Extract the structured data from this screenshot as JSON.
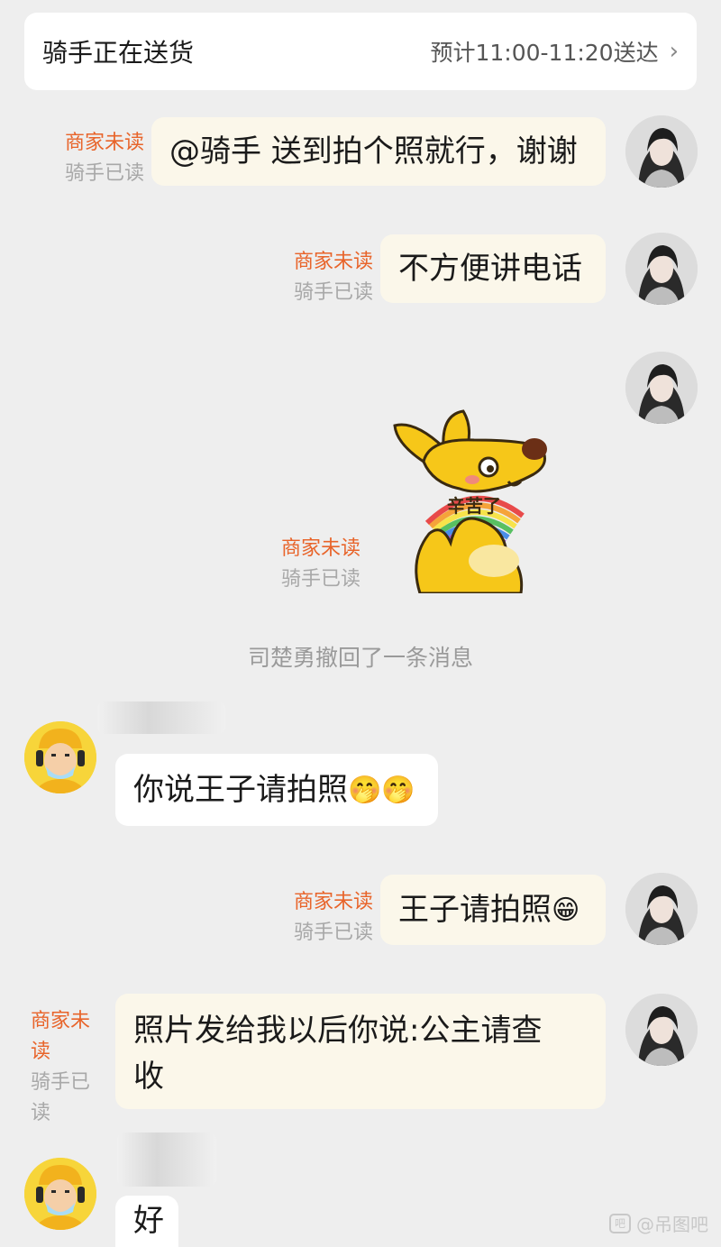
{
  "header": {
    "status": "骑手正在送货",
    "eta": "预计11:00-11:20送达",
    "chevron": "›"
  },
  "messages": [
    {
      "text": "@骑手 送到拍个照就行，谢谢",
      "unread": "商家未读",
      "read": "骑手已读"
    },
    {
      "text": "不方便讲电话",
      "unread": "商家未读",
      "read": "骑手已读"
    },
    {
      "sticker_text": "辛苦了",
      "unread": "商家未读",
      "read": "骑手已读"
    },
    {
      "text": "你说王子请拍照",
      "emoji": "🤭🤭"
    },
    {
      "text": "王子请拍照",
      "emoji": "😁",
      "unread": "商家未读",
      "read": "骑手已读"
    },
    {
      "line1": "照片发给我以后你说:公主请查",
      "line2": "收",
      "unread1": "商家未",
      "unread2": "读",
      "read1": "骑手已",
      "read2": "读"
    },
    {
      "text": "好"
    }
  ],
  "recall_notice": "司楚勇撤回了一条消息",
  "watermark": "@吊图吧",
  "watermark_icon": "吧",
  "colors": {
    "unread": "#e8642a",
    "read": "#a8a8a8",
    "bubble_self": "#fbf7ea",
    "bubble_rider": "#ffffff",
    "sticker_body": "#f6c719"
  }
}
